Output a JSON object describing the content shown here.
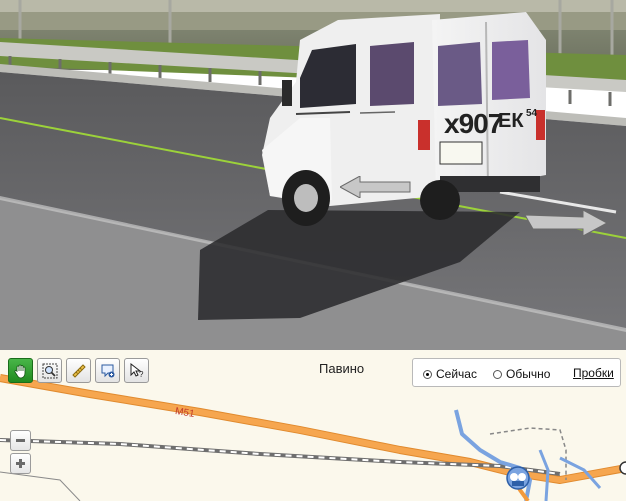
{
  "map": {
    "place_label": "Павино",
    "route_label": "М51",
    "traffic": {
      "now_label": "Сейчас",
      "usual_label": "Обычно",
      "traffic_link": "Пробки",
      "selected": "now"
    }
  },
  "vehicle": {
    "plate_text": "х907",
    "plate_series": "ЕК",
    "plate_region": "54"
  },
  "toolbar": {
    "tools": [
      "hand-icon",
      "zoom-area-icon",
      "ruler-icon",
      "balloon-icon",
      "cursor-help-icon"
    ]
  },
  "colors": {
    "road_orange": "#f39a3c",
    "water_blue": "#7aa3e0",
    "map_bg": "#fbf8ec",
    "nav_line": "#9cd23a"
  }
}
